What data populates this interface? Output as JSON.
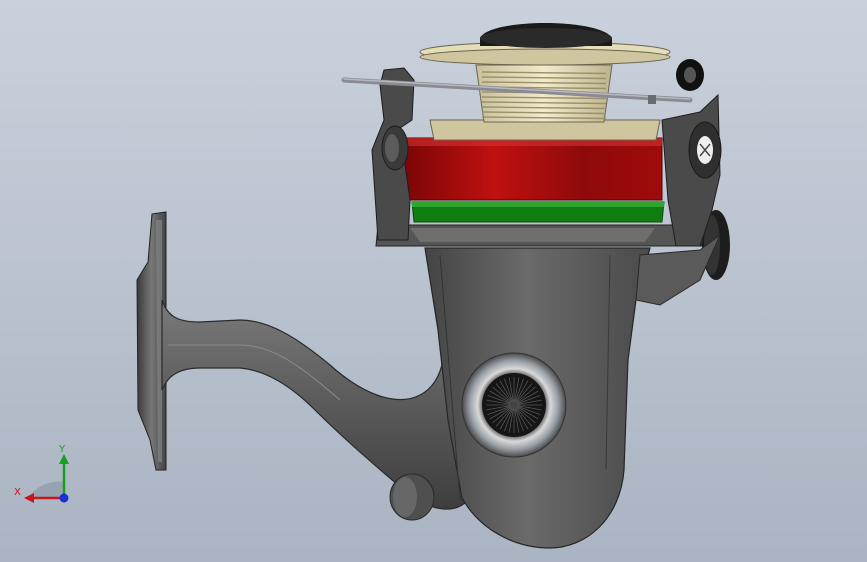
{
  "viewport": {
    "background_top": "#c9d1dc",
    "background_bottom": "#aab4c2"
  },
  "model": {
    "name_icon": "spinning-reel-3d-model",
    "body_color": "#5a5a5a",
    "spool_rim_color": "#e3ddb8",
    "spool_line_color": "#cfc6a0",
    "drag_band_color": "#b30e0e",
    "drag_skirt_color": "#0f7d0f",
    "knob_color": "#1a1a1a",
    "bail_color": "#7c7c84"
  },
  "triad": {
    "x_label": "X",
    "y_label": "Y",
    "x_color": "#c8141e",
    "y_color": "#16a01e",
    "z_color": "#1a2fd0"
  }
}
